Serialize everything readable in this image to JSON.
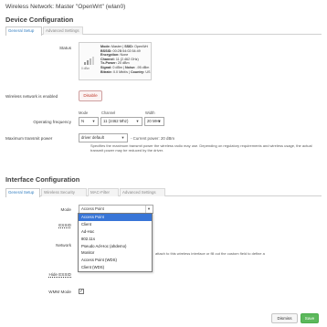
{
  "page_title": "Wireless Network: Master \"OpenWrt\" (wlan0)",
  "device_config": {
    "title": "Device Configuration",
    "tabs": [
      "General Setup",
      "Advanced Settings"
    ],
    "status_label": "Status",
    "status": {
      "signal_caption": "0 dBm",
      "mode_label": "Mode:",
      "mode_value": "Master",
      "ssid_label": "SSID:",
      "ssid_value": "OpenWrt",
      "bssid_label": "BSSID:",
      "bssid_value": "00:2B:54:02:54:49",
      "encryption_label": "Encryption:",
      "encryption_value": "None",
      "channel_label": "Channel:",
      "channel_value": "11 (2.462 GHz)",
      "txpower_label": "Tx-Power:",
      "txpower_value": "20 dBm",
      "signal_label": "Signal:",
      "signal_value": "0 dBm",
      "noise_label": "Noise:",
      "noise_value": "-95 dBm",
      "bitrate_label": "Bitrate:",
      "bitrate_value": "0.0 Mbit/s",
      "country_label": "Country:",
      "country_value": "US"
    },
    "enabled_label": "Wireless network is enabled",
    "disable_button": "Disable",
    "freq": {
      "label": "Operating frequency",
      "mode_caption": "Mode",
      "channel_caption": "Channel",
      "width_caption": "Width",
      "mode_value": "N",
      "channel_value": "11 (2462 Mhz)",
      "width_value": "20 MHz"
    },
    "tx": {
      "label": "Maximum transmit power",
      "value": "driver default",
      "current": "- Current power: 20 dBm",
      "help": "Specifies the maximum transmit power the wireless radio may use. Depending on regulatory requirements and wireless usage, the actual transmit power may be reduced by the driver."
    }
  },
  "interface_config": {
    "title": "Interface Configuration",
    "tabs": [
      "General Setup",
      "Wireless Security",
      "MAC-Filter",
      "Advanced Settings"
    ],
    "mode_label": "Mode",
    "mode_value": "Access Point",
    "essid_label": "ESSID",
    "network_label": "Network",
    "network_help": "attach to this wireless interface or fill out the custom field to define a",
    "hide_essid_label": "Hide ESSID",
    "wmm_label": "WMM Mode",
    "wmm_checked": "✓",
    "dropdown_options": [
      "Access Point",
      "Client",
      "Ad-Hoc",
      "802.11s",
      "Pseudo Ad-Hoc (ahdemo)",
      "Monitor",
      "Access Point (WDS)",
      "Client (WDS)"
    ]
  },
  "actions": {
    "dismiss": "Dismiss",
    "save": "Save"
  },
  "colors": {
    "accent_blue": "#2f7cc0",
    "selected_option": "#3875d7",
    "disable_red": "#c0392b",
    "save_green": "#5cb85c"
  }
}
